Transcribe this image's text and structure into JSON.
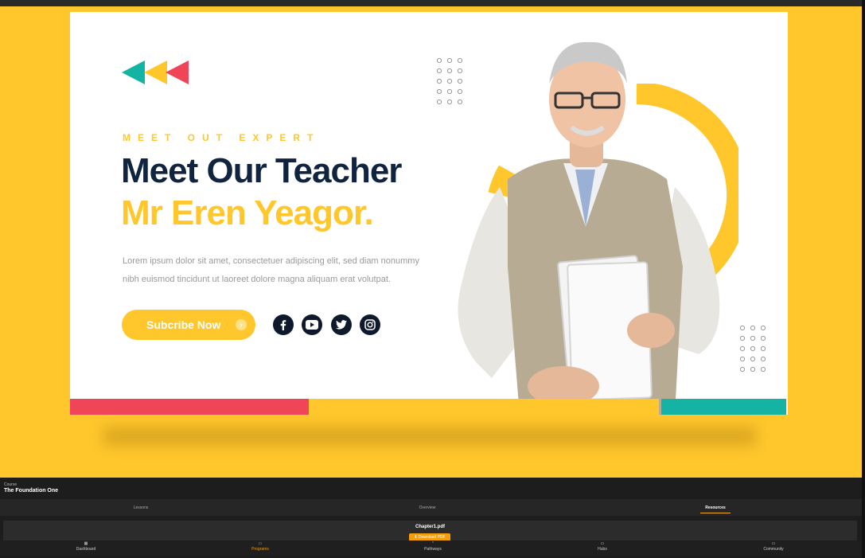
{
  "banner": {
    "eyebrow": "MEET OUT EXPERT",
    "title": "Meet Our Teacher",
    "name": "Mr Eren Yeagor.",
    "body_line1": "Lorem ipsum dolor sit amet, consectetuer adipiscing elit, sed diam nonummy",
    "body_line2": "nibh euismod tincidunt ut laoreet dolore magna aliquam erat volutpat.",
    "cta": "Subcribe Now",
    "social": [
      "facebook-icon",
      "youtube-icon",
      "twitter-icon",
      "instagram-icon"
    ],
    "colors": {
      "yellow": "#ffc72c",
      "navy": "#10233f",
      "teal": "#14b3a4",
      "red": "#f04457"
    }
  },
  "course": {
    "label": "Course",
    "title": "The Foundation One"
  },
  "tabs": {
    "lessons": "Lessons",
    "overview": "Overview",
    "resources": "Resources",
    "active": "Resources"
  },
  "resource": {
    "file": "Chapter1.pdf",
    "download": "⬇ Download PDF"
  },
  "nav": {
    "dashboard": "Dashboard",
    "programs": "Programs",
    "pathways": "Pathways",
    "hubs": "Hubs",
    "community": "Community",
    "active": "Programs"
  }
}
